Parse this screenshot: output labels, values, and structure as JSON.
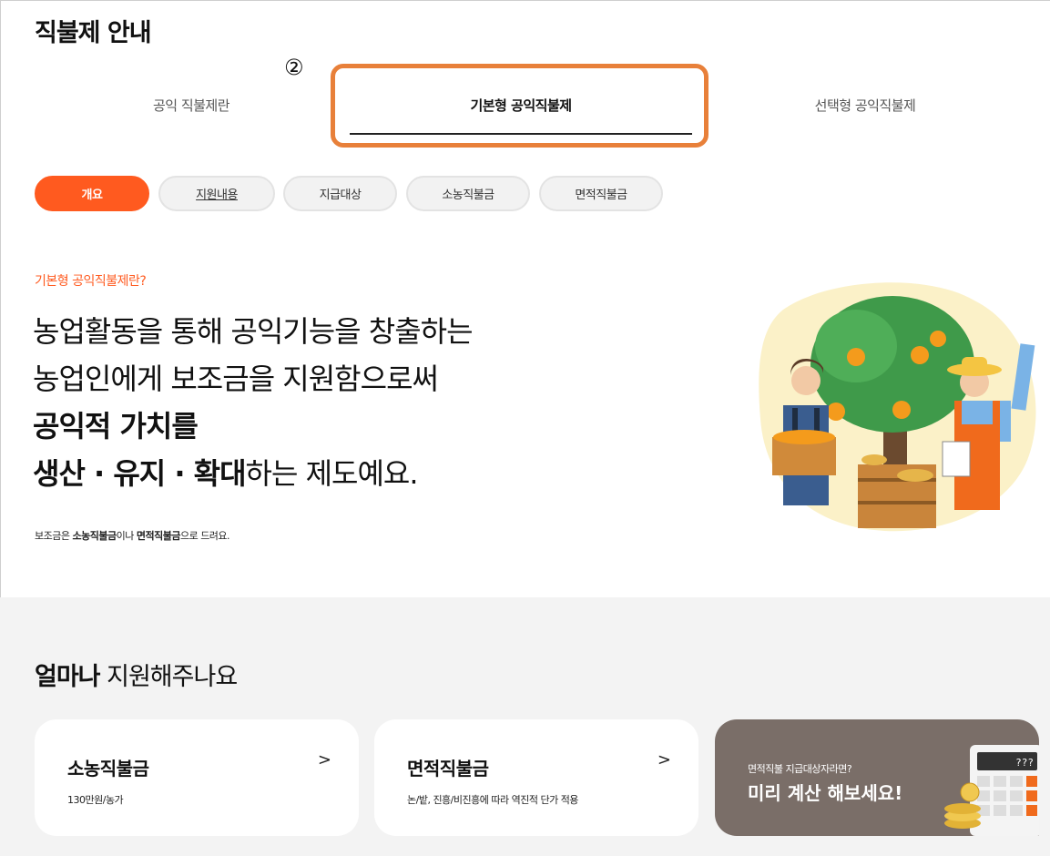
{
  "page_title": "직불제 안내",
  "annotation_number": "②",
  "tabs": [
    {
      "label": "공익 직불제란"
    },
    {
      "label": "기본형 공익직불제"
    },
    {
      "label": "선택형 공익직불제"
    }
  ],
  "pills": [
    {
      "label": "개요"
    },
    {
      "label": "지원내용"
    },
    {
      "label": "지급대상"
    },
    {
      "label": "소농직불금"
    },
    {
      "label": "면적직불금"
    }
  ],
  "intro": {
    "label": "기본형 공익직불제란?",
    "line1": "농업활동을 통해 공익기능을 창출하는",
    "line2": "농업인에게 보조금을 지원함으로써",
    "line3": "공익적 가치를",
    "line4_bold": "생산 · 유지 · 확대",
    "line4_rest": "하는 제도예요.",
    "footnote_pre": "보조금은 ",
    "footnote_b1": "소농직불금",
    "footnote_mid": "이나 ",
    "footnote_b2": "면적직불금",
    "footnote_post": "으로 드려요."
  },
  "section": {
    "title_bold": "얼마나",
    "title_rest": " 지원해주나요"
  },
  "cards": [
    {
      "title": "소농직불금",
      "subtitle": "130만원/농가",
      "chevron": ">"
    },
    {
      "title": "면적직불금",
      "subtitle": "논/밭, 진흥/비진흥에 따라 역진적 단가 적용",
      "chevron": ">"
    }
  ],
  "calc_card": {
    "subtitle": "면적직불 지급대상자라면?",
    "title": "미리 계산 해보세요!",
    "display": "???"
  },
  "colors": {
    "accent": "#ff5a1f",
    "highlight": "#e8803a",
    "calc_card_bg": "#7a6e68",
    "section_bg": "#f3f3f3"
  }
}
